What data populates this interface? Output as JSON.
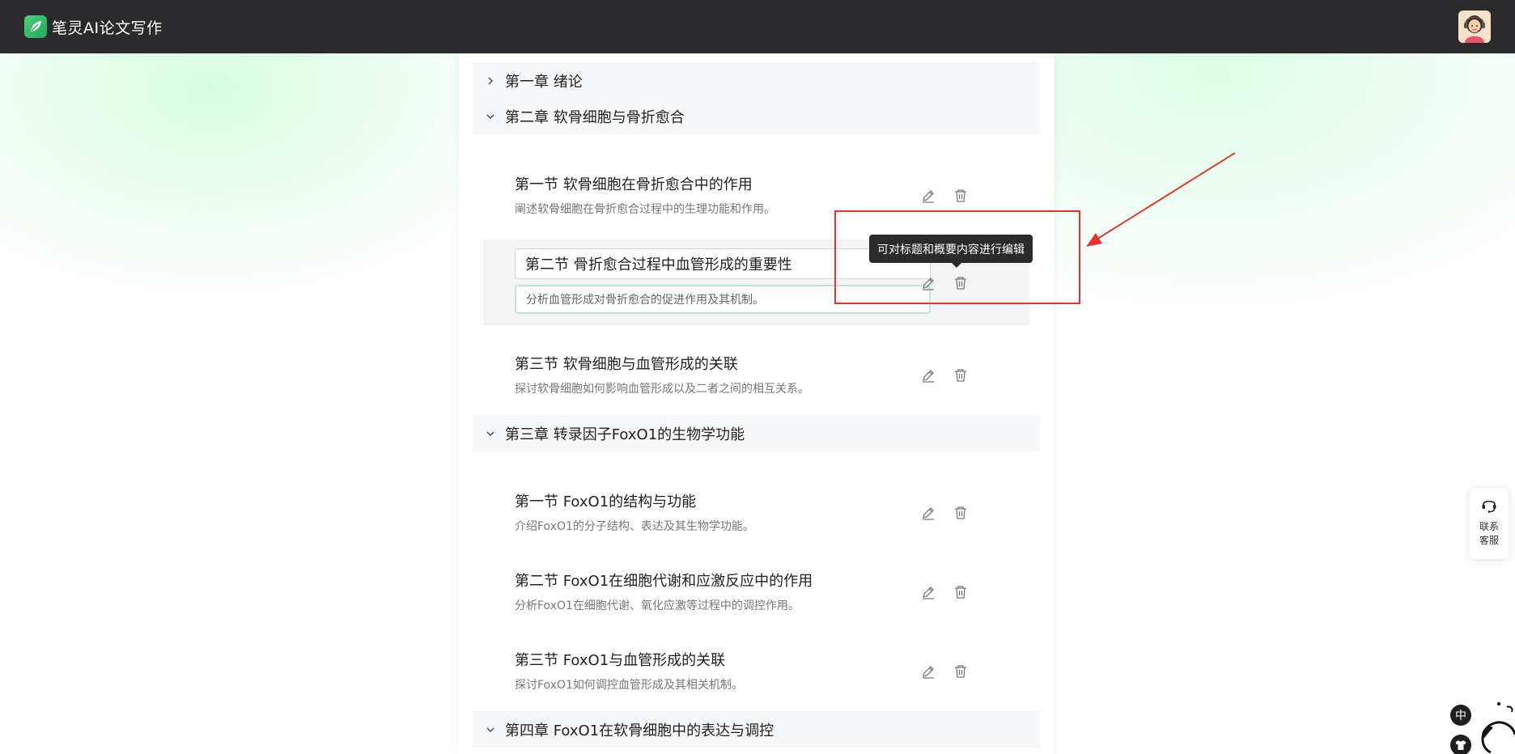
{
  "header": {
    "brand": "笔灵AI论文写作"
  },
  "outline": {
    "chapters": [
      {
        "title": "第一章 绪论",
        "expanded": false
      },
      {
        "title": "第二章 软骨细胞与骨折愈合",
        "expanded": true
      },
      {
        "title": "第三章 转录因子FoxO1的生物学功能",
        "expanded": true
      },
      {
        "title": "第四章 FoxO1在软骨细胞中的表达与调控",
        "expanded": true
      }
    ],
    "sections": [
      {
        "title": "第一节 软骨细胞在骨折愈合中的作用",
        "desc": "阐述软骨细胞在骨折愈合过程中的生理功能和作用。"
      },
      {
        "title": "第二节 骨折愈合过程中血管形成的重要性",
        "desc": "分析血管形成对骨折愈合的促进作用及其机制。"
      },
      {
        "title": "第三节 软骨细胞与血管形成的关联",
        "desc": "探讨软骨细胞如何影响血管形成以及二者之间的相互关系。"
      },
      {
        "title": "第一节 FoxO1的结构与功能",
        "desc": "介绍FoxO1的分子结构、表达及其生物学功能。"
      },
      {
        "title": "第二节 FoxO1在细胞代谢和应激反应中的作用",
        "desc": "分析FoxO1在细胞代谢、氧化应激等过程中的调控作用。"
      },
      {
        "title": "第三节 FoxO1与血管形成的关联",
        "desc": "探讨FoxO1如何调控血管形成及其相关机制。"
      }
    ]
  },
  "tooltip": "可对标题和概要内容进行编辑",
  "support": {
    "label": "联系客服"
  },
  "language_button": "中",
  "colors": {
    "header_bg": "#2b2b2d",
    "accent_green": "#1fa75a",
    "annotation_red": "#e8332a"
  },
  "icons": {
    "edit": "pencil-icon",
    "delete": "trash-icon",
    "expand": "chevron-down-icon",
    "collapsed": "chevron-right-icon",
    "support": "headset-icon"
  }
}
